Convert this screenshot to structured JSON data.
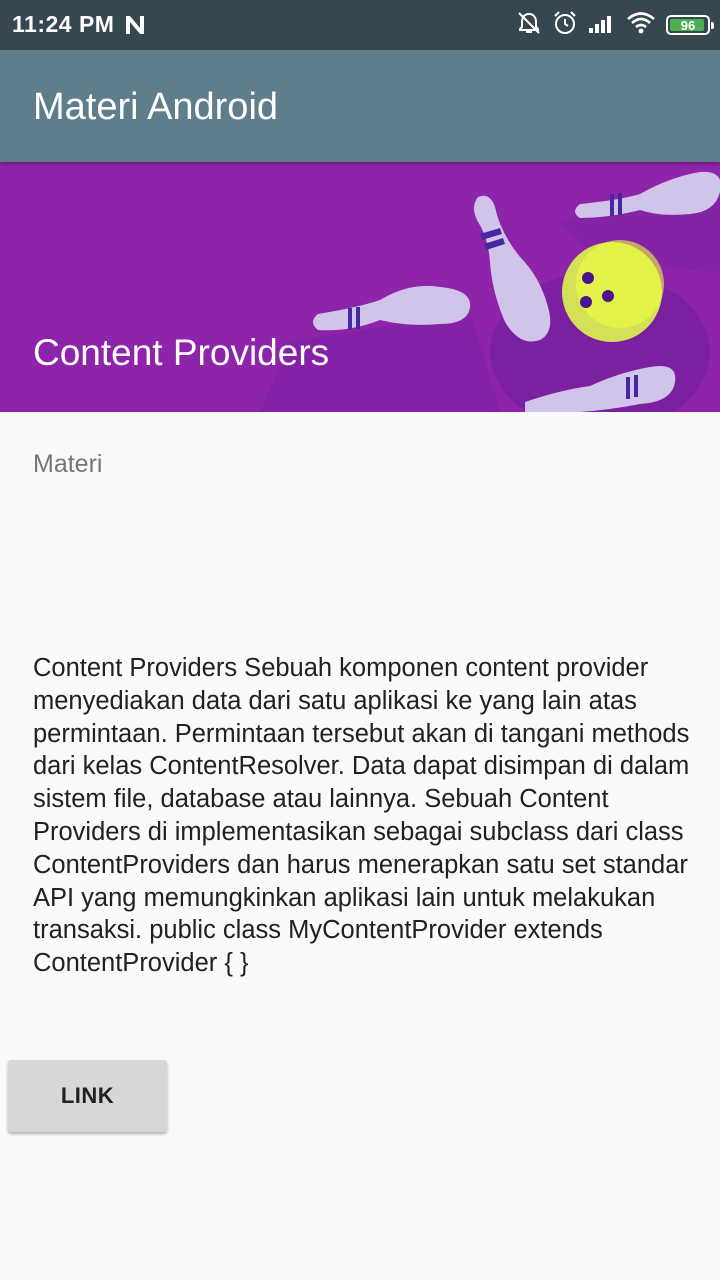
{
  "status_bar": {
    "time": "11:24 PM",
    "notification_icon": "n-icon",
    "icons": [
      "alarm-off-icon",
      "alarm-icon",
      "signal-icon",
      "wifi-icon"
    ],
    "battery_level": "96",
    "battery_color": "#4caf50"
  },
  "app_bar": {
    "title": "Materi Android",
    "color": "#607d8b"
  },
  "banner": {
    "title": "Content Providers",
    "color": "#8e24aa",
    "illustration": "bowling-pins-and-ball"
  },
  "section": {
    "label": "Materi"
  },
  "content": {
    "text": "Content Providers Sebuah komponen content provider menyediakan data dari satu aplikasi ke yang lain atas permintaan. Permintaan tersebut akan di tangani methods dari kelas ContentResolver. Data dapat disimpan di dalam sistem file, database atau lainnya. Sebuah Content Providers di implementasikan sebagai subclass dari class ContentProviders dan harus menerapkan satu set standar API yang memungkinkan aplikasi lain untuk melakukan transaksi. public class MyContentProvider extends ContentProvider { }"
  },
  "actions": {
    "link_label": "LINK"
  }
}
